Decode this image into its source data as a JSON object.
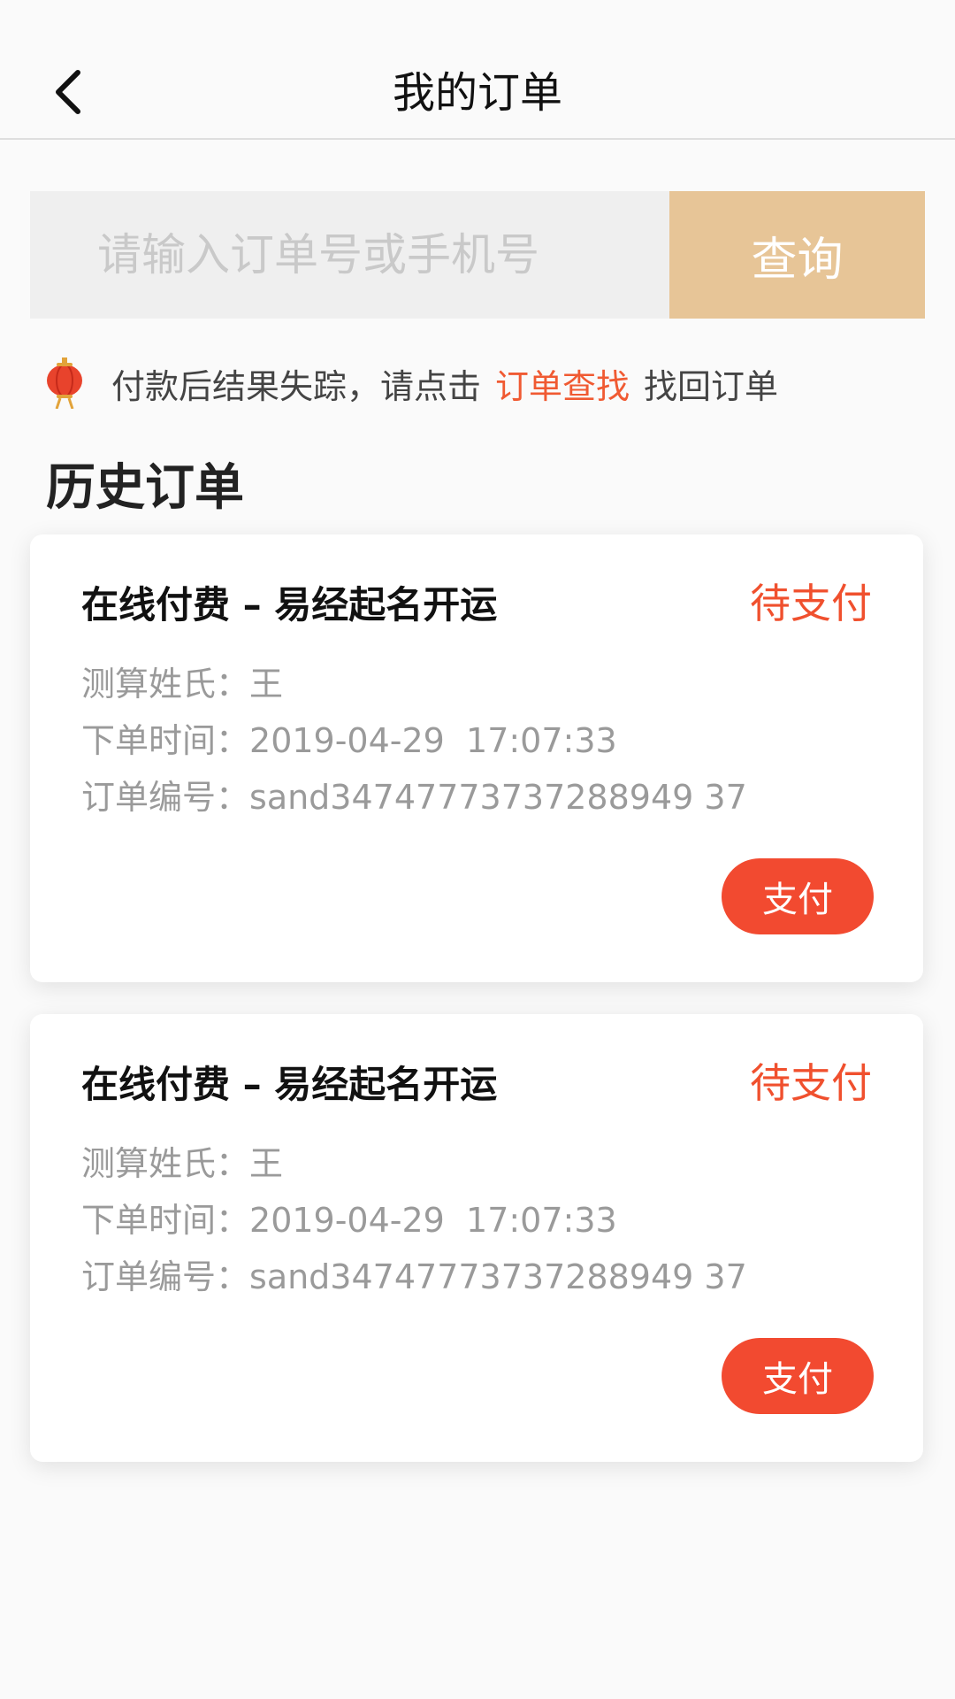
{
  "header": {
    "title": "我的订单",
    "back_icon": "chevron-left-icon"
  },
  "search": {
    "placeholder": "请输入订单号或手机号",
    "button_label": "查询"
  },
  "notice": {
    "icon": "lantern-icon",
    "text_before": "付款后结果失踪，请点击",
    "link_text": "订单查找",
    "text_after": "找回订单"
  },
  "section": {
    "title": "历史订单"
  },
  "orders": [
    {
      "title": "在线付费 – 易经起名开运",
      "status": "待支付",
      "surname_label": "测算姓氏：",
      "surname": "王",
      "time_label": "下单时间：",
      "time": "2019-04-29  17:07:33",
      "order_no_label": "订单编号：",
      "order_no": "sand34747773737288949 37",
      "pay_label": "支付"
    },
    {
      "title": "在线付费 – 易经起名开运",
      "status": "待支付",
      "surname_label": "测算姓氏：",
      "surname": "王",
      "time_label": "下单时间：",
      "time": "2019-04-29  17:07:33",
      "order_no_label": "订单编号：",
      "order_no": "sand34747773737288949 37",
      "pay_label": "支付"
    }
  ],
  "colors": {
    "accent": "#f0502e",
    "button": "#f24a30",
    "search_button": "#e7c597"
  }
}
